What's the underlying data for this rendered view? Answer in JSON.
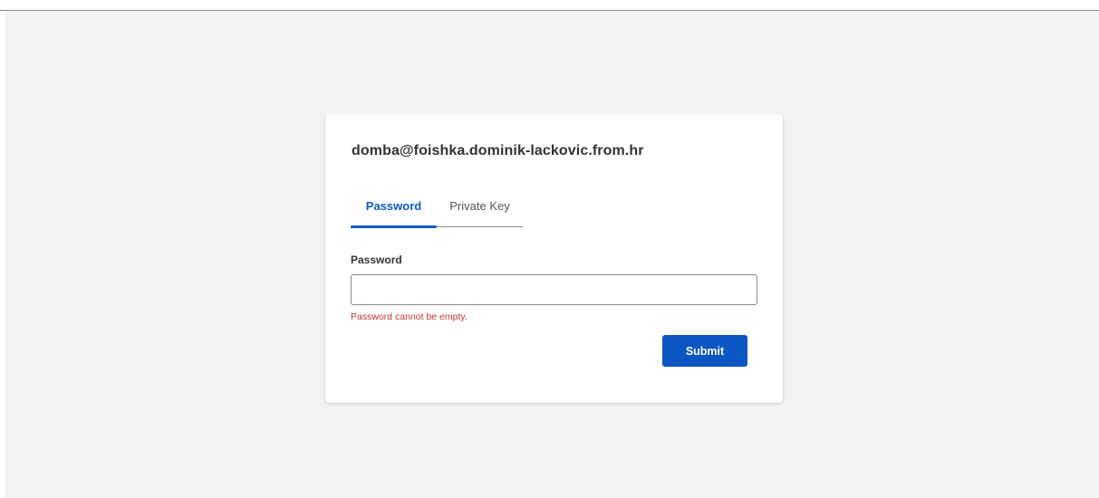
{
  "login": {
    "host_title": "domba@foishka.dominik-lackovic.from.hr",
    "tabs": [
      {
        "label": "Password",
        "active": true
      },
      {
        "label": "Private Key",
        "active": false
      }
    ],
    "password_field": {
      "label": "Password",
      "value": "",
      "placeholder": ""
    },
    "error_message": "Password cannot be empty.",
    "submit_label": "Submit"
  },
  "colors": {
    "page_background": "#f2f2f2",
    "card_background": "#ffffff",
    "accent": "#0f5cc0",
    "button": "#0b56c2",
    "error": "#c0392b"
  }
}
